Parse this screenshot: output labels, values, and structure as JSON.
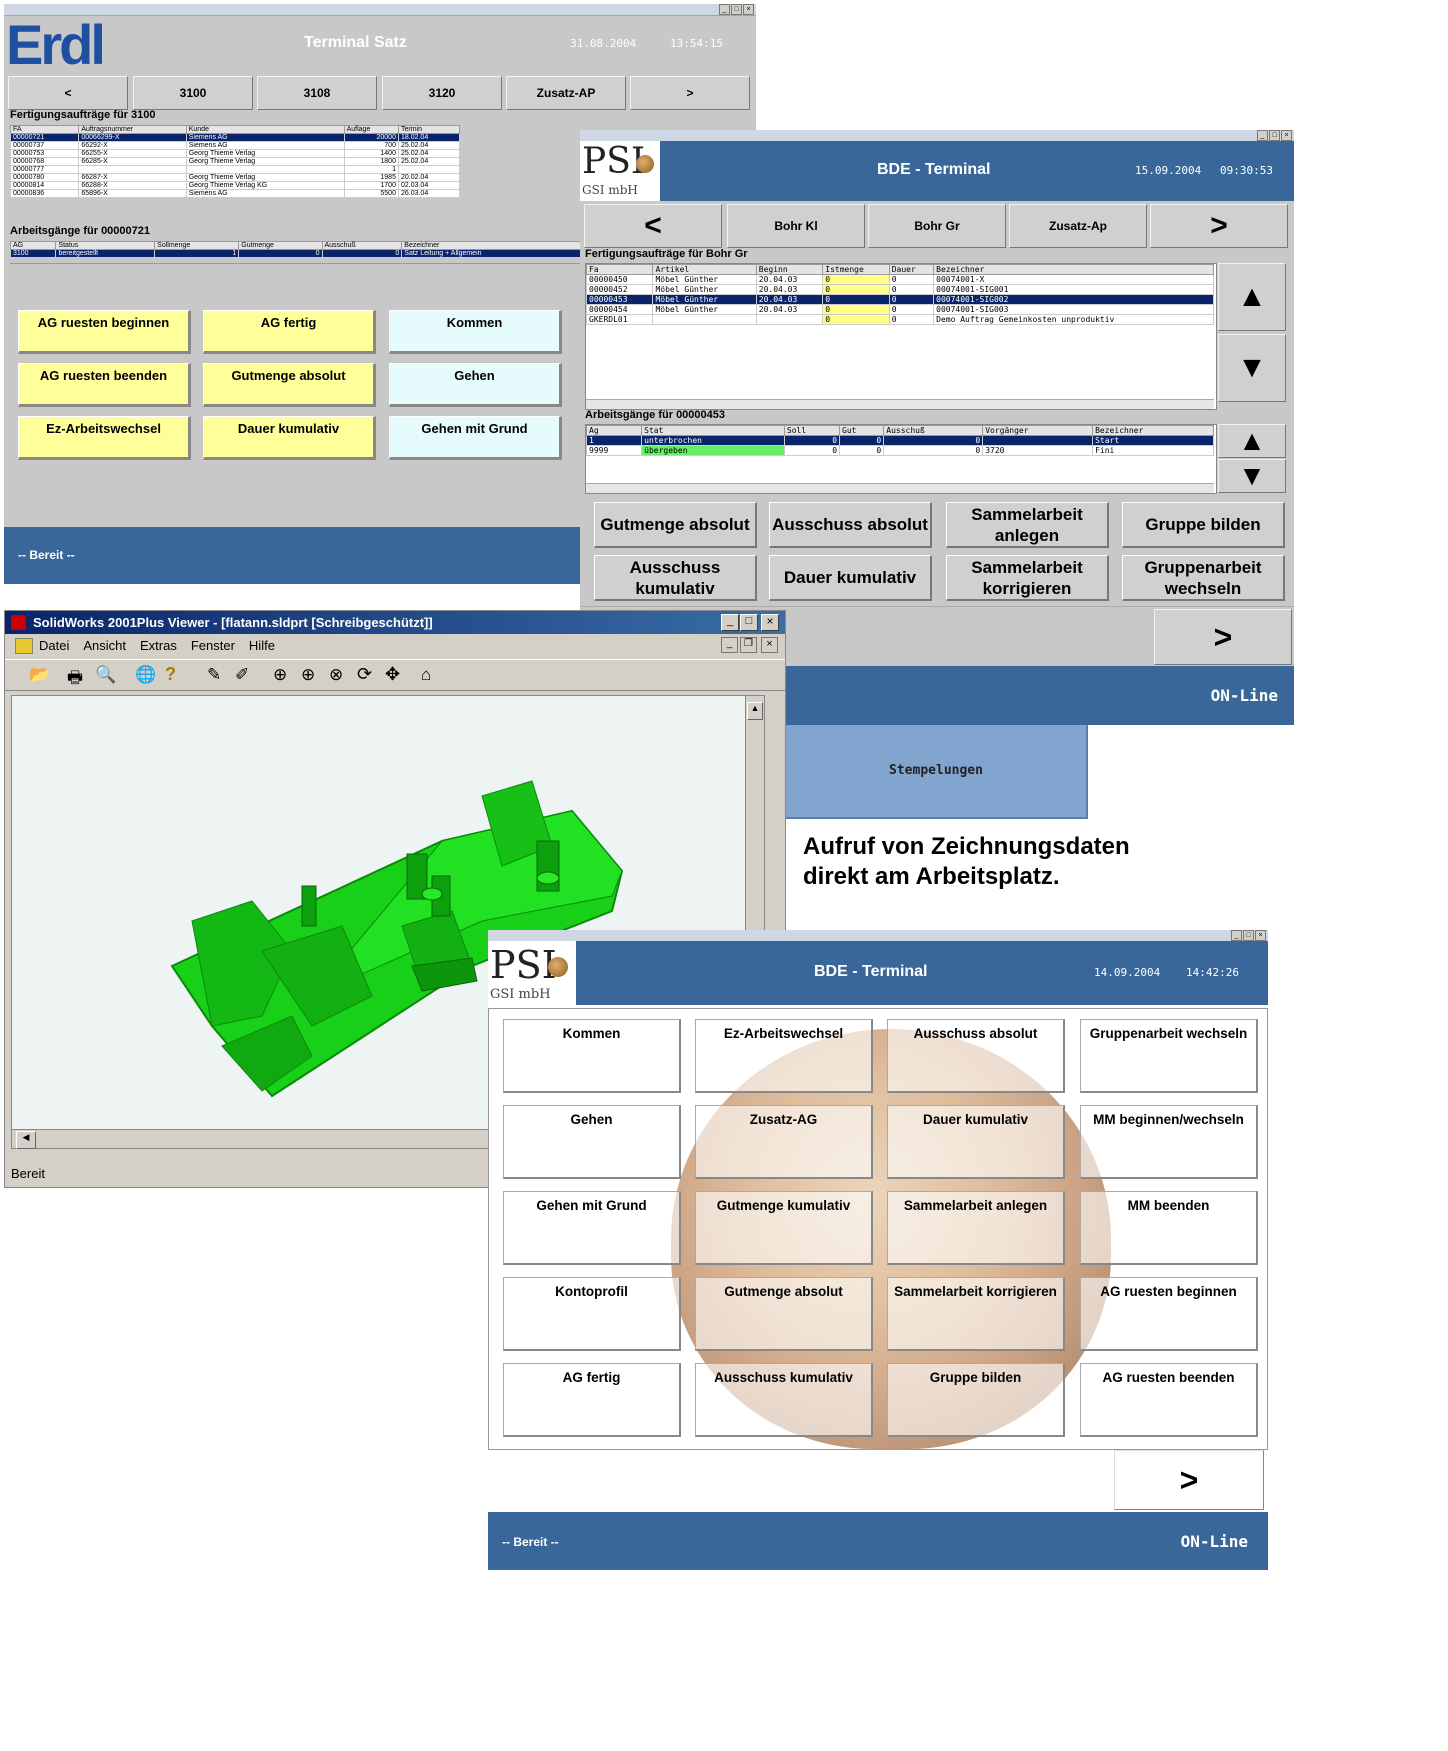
{
  "erdl": {
    "logo": "Erdl",
    "title": "Terminal Satz",
    "date": "31.08.2004",
    "time": "13:54:15",
    "nav": [
      "<",
      "3100",
      "3108",
      "3120",
      "Zusatz-AP",
      ">"
    ],
    "orders_title": "Fertigungsaufträge für 3100",
    "orders_headers": [
      "FA",
      "Auftragsnummer",
      "Kunde",
      "Auflage",
      "Termin"
    ],
    "orders": [
      [
        "00000721",
        "00066299-X",
        "Siemens AG",
        "20000",
        "18.02.04"
      ],
      [
        "00000737",
        "66292-X",
        "Siemens AG",
        "700",
        "25.02.04"
      ],
      [
        "00000753",
        "66255-X",
        "Georg Thieme Verlag",
        "1400",
        "25.02.04"
      ],
      [
        "00000768",
        "66285-X",
        "Georg Thieme Verlag",
        "1800",
        "25.02.04"
      ],
      [
        "00000777",
        "",
        "",
        "1",
        ""
      ],
      [
        "00000780",
        "66287-X",
        "Georg Thieme Verlag",
        "1985",
        "20.02.04"
      ],
      [
        "00000814",
        "66288-X",
        "Georg Thieme Verlag KG",
        "1700",
        "02.03.04"
      ],
      [
        "00000836",
        "65896-X",
        "Siemens AG",
        "5500",
        "26.03.04"
      ]
    ],
    "ops_title": "Arbeitsgänge für 00000721",
    "ops_headers": [
      "AG",
      "Status",
      "Sollmenge",
      "Gutmenge",
      "Ausschuß",
      "Bezeichner"
    ],
    "ops": [
      [
        "3100",
        "bereitgestellt",
        "1",
        "0",
        "0",
        "Satz Leitung + Allgemein"
      ]
    ],
    "buttons": [
      [
        "AG ruesten beginnen",
        "AG fertig",
        "Kommen"
      ],
      [
        "AG ruesten beenden",
        "Gutmenge absolut",
        "Gehen"
      ],
      [
        "Ez-Arbeitswechsel",
        "Dauer kumulativ",
        "Gehen mit Grund"
      ]
    ],
    "status": "-- Bereit --"
  },
  "psi_top": {
    "logo": "PSI",
    "logo_sub": "GSI mbH",
    "title": "BDE - Terminal",
    "date": "15.09.2004",
    "time": "09:30:53",
    "nav": [
      "<",
      "Bohr Kl",
      "Bohr Gr",
      "Zusatz-Ap",
      ">"
    ],
    "orders_title": "Fertigungsaufträge für Bohr Gr",
    "orders_headers": [
      "Fa",
      "Artikel",
      "Beginn",
      "Istmenge",
      "Dauer",
      "Bezeichner"
    ],
    "orders": [
      [
        "00000450",
        "Möbel Günther",
        "20.04.03",
        "0",
        "0",
        "00074001-X"
      ],
      [
        "00000452",
        "Möbel Günther",
        "20.04.03",
        "0",
        "0",
        "00074001-SIG001"
      ],
      [
        "00000453",
        "Möbel Günther",
        "20.04.03",
        "0",
        "0",
        "00074001-SIG002"
      ],
      [
        "00000454",
        "Möbel Günther",
        "20.04.03",
        "0",
        "0",
        "00074001-SIG003"
      ],
      [
        "GKERDL01",
        "",
        "",
        "0",
        "0",
        "Demo Auftrag Gemeinkosten unproduktiv"
      ]
    ],
    "ops_title": "Arbeitsgänge für 00000453",
    "ops_headers": [
      "Ag",
      "Stat",
      "Soll",
      "Gut",
      "Ausschuß",
      "Vorgänger",
      "Bezeichner"
    ],
    "ops": [
      [
        "1",
        "unterbrochen",
        "0",
        "0",
        "0",
        "",
        "Start"
      ],
      [
        "9999",
        "übergeben",
        "0",
        "0",
        "0",
        "3720",
        "Fini"
      ]
    ],
    "buttons": [
      "Gutmenge absolut",
      "Ausschuss absolut",
      "Sammelarbeit anlegen",
      "Gruppe bilden",
      "Ausschuss kumulativ",
      "Dauer kumulativ",
      "Sammelarbeit korrigieren",
      "Gruppenarbeit wechseln"
    ],
    "next": ">",
    "online": "ON-Line",
    "stempel": "Stempelungen"
  },
  "solidworks": {
    "title": "SolidWorks 2001Plus Viewer - [flatann.sldprt [Schreibgeschützt]]",
    "menu": [
      "Datei",
      "Ansicht",
      "Extras",
      "Fenster",
      "Hilfe"
    ],
    "status": "Bereit"
  },
  "caption": {
    "line1": "Aufruf von Zeichnungsdaten",
    "line2": "direkt am Arbeitsplatz."
  },
  "psi_bottom": {
    "logo": "PSI",
    "logo_sub": "GSI mbH",
    "title": "BDE - Terminal",
    "date": "14.09.2004",
    "time": "14:42:26",
    "buttons": [
      "Kommen",
      "Ez-Arbeitswechsel",
      "Ausschuss absolut",
      "Gruppenarbeit wechseln",
      "Gehen",
      "Zusatz-AG",
      "Dauer kumulativ",
      "MM beginnen/wechseln",
      "Gehen mit Grund",
      "Gutmenge kumulativ",
      "Sammelarbeit anlegen",
      "MM beenden",
      "Kontoprofil",
      "Gutmenge absolut",
      "Sammelarbeit korrigieren",
      "AG ruesten beginnen",
      "AG fertig",
      "Ausschuss kumulativ",
      "Gruppe bilden",
      "AG ruesten beenden"
    ],
    "next": ">",
    "status": "-- Bereit --",
    "online": "ON-Line"
  },
  "colors": {
    "header_blue": "#39679a",
    "btn_yellow": "#ffff99",
    "btn_cyan": "#e6fcfc",
    "selected_row": "#0a246a",
    "model_green": "#19d019"
  }
}
